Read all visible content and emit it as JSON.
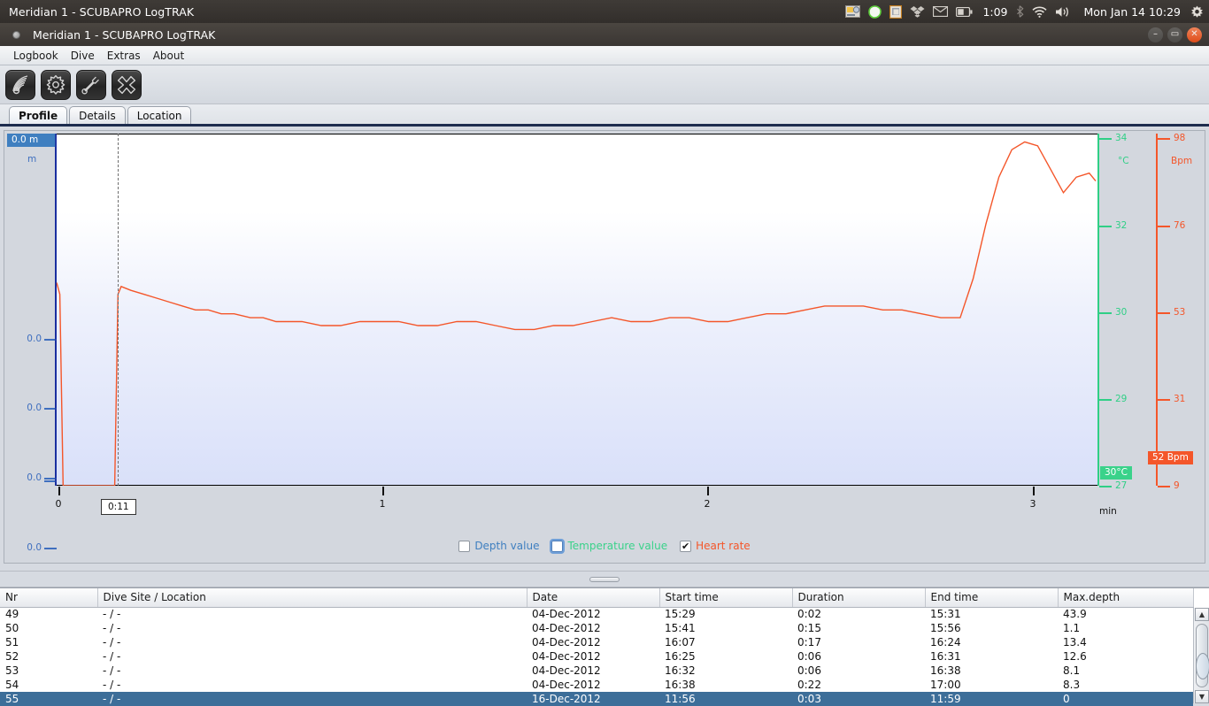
{
  "os_panel": {
    "title": "Meridian 1 - SCUBAPRO LogTRAK",
    "battery_time": "1:09",
    "clock": "Mon Jan 14  10:29",
    "tray_icons": [
      "screenshot-icon",
      "notes-icon",
      "clipboard-icon",
      "dropbox-icon",
      "mail-icon",
      "battery-icon",
      "bluetooth-icon",
      "wifi-icon",
      "volume-icon",
      "system-gear-icon"
    ]
  },
  "window": {
    "title": "Meridian 1 - SCUBAPRO LogTRAK",
    "minimize_label": "–",
    "maximize_label": "▭",
    "close_label": "✕"
  },
  "menu": {
    "items": [
      {
        "label": "Logbook"
      },
      {
        "label": "Dive"
      },
      {
        "label": "Extras"
      },
      {
        "label": "About"
      }
    ]
  },
  "toolbar": {
    "buttons": [
      {
        "name": "ir-transfer-icon"
      },
      {
        "name": "settings-gear-icon"
      },
      {
        "name": "tools-wrench-icon"
      },
      {
        "name": "close-x-icon"
      }
    ]
  },
  "tabs": [
    {
      "label": "Profile",
      "active": true
    },
    {
      "label": "Details",
      "active": false
    },
    {
      "label": "Location",
      "active": false
    }
  ],
  "chart_data": {
    "type": "line",
    "title": "",
    "xlabel": "min",
    "x_ticks": [
      0,
      1,
      2,
      3
    ],
    "xlim": [
      0,
      3.22
    ],
    "cursor_time": "0:11",
    "axes": [
      {
        "name": "depth",
        "unit": "m",
        "color": "#3f7fc0",
        "tick_labels": [
          "0.0",
          "0.0",
          "0.0",
          "0.0",
          "0.0"
        ],
        "tick_values": [
          0.0,
          0.0,
          0.0,
          0.0,
          0.0
        ],
        "badge": "0.0 m",
        "side": "left"
      },
      {
        "name": "temperature",
        "unit": "°C",
        "color": "#3ad28a",
        "tick_labels": [
          "34",
          "32",
          "30",
          "29",
          "27"
        ],
        "tick_values": [
          34,
          32,
          30,
          29,
          27
        ],
        "badge": "30°C",
        "side": "right"
      },
      {
        "name": "heart_rate",
        "unit": "Bpm",
        "color": "#f4562a",
        "tick_labels": [
          "98",
          "76",
          "53",
          "31",
          "9"
        ],
        "tick_values": [
          98,
          76,
          53,
          31,
          9
        ],
        "badge": "52 Bpm",
        "side": "right"
      }
    ],
    "series": [
      {
        "name": "Heart rate",
        "color": "#f4562a",
        "unit": "Bpm",
        "x": [
          0.0,
          0.01,
          0.02,
          0.18,
          0.19,
          0.2,
          0.23,
          0.27,
          0.31,
          0.35,
          0.39,
          0.43,
          0.47,
          0.51,
          0.55,
          0.6,
          0.64,
          0.68,
          0.72,
          0.76,
          0.82,
          0.88,
          0.94,
          1.0,
          1.06,
          1.12,
          1.18,
          1.24,
          1.3,
          1.36,
          1.42,
          1.48,
          1.54,
          1.6,
          1.66,
          1.72,
          1.78,
          1.84,
          1.9,
          1.96,
          2.02,
          2.08,
          2.14,
          2.2,
          2.26,
          2.32,
          2.38,
          2.44,
          2.5,
          2.56,
          2.62,
          2.68,
          2.74,
          2.8,
          2.84,
          2.88,
          2.92,
          2.96,
          3.0,
          3.04,
          3.08,
          3.12,
          3.16,
          3.2,
          3.22
        ],
        "values": [
          61,
          58,
          9,
          9,
          58,
          60,
          59,
          58,
          57,
          56,
          55,
          54,
          54,
          53,
          53,
          52,
          52,
          51,
          51,
          51,
          50,
          50,
          51,
          51,
          51,
          50,
          50,
          51,
          51,
          50,
          49,
          49,
          50,
          50,
          51,
          52,
          51,
          51,
          52,
          52,
          51,
          51,
          52,
          53,
          53,
          54,
          55,
          55,
          55,
          54,
          54,
          53,
          52,
          52,
          62,
          76,
          88,
          95,
          97,
          96,
          90,
          84,
          88,
          89,
          87
        ],
        "note": "Heart-rate trace; spike to 61 at start then drop to 9, resume at 0.19 min, mostly flat 49-55 Bpm, sharp rise after 2.8 min peaking ~97 Bpm near 3.05 min, dip then recovery"
      }
    ],
    "depth_trace": {
      "name": "Depth",
      "color": "#1a2fa0",
      "note": "Depth line collapsed at axis (all values 0.0 m)"
    },
    "legend": {
      "position": "bottom-center",
      "items": [
        {
          "label": "Depth value",
          "checked": false,
          "color": "#3f7fc0"
        },
        {
          "label": "Temperature value",
          "checked": false,
          "color": "#3ad28a",
          "focused": true
        },
        {
          "label": "Heart rate",
          "checked": true,
          "color": "#f4562a"
        }
      ]
    }
  },
  "table": {
    "columns": [
      "Nr",
      "Dive Site / Location",
      "Date",
      "Start time",
      "Duration",
      "End time",
      "Max.depth"
    ],
    "rows": [
      {
        "nr": "49",
        "site": "- / -",
        "date": "04-Dec-2012",
        "start": "15:29",
        "duration": "0:02",
        "end": "15:31",
        "max_depth": "43.9",
        "clipped": true,
        "selected": false
      },
      {
        "nr": "50",
        "site": "- / -",
        "date": "04-Dec-2012",
        "start": "15:41",
        "duration": "0:15",
        "end": "15:56",
        "max_depth": "1.1",
        "clipped": false,
        "selected": false
      },
      {
        "nr": "51",
        "site": "- / -",
        "date": "04-Dec-2012",
        "start": "16:07",
        "duration": "0:17",
        "end": "16:24",
        "max_depth": "13.4",
        "clipped": false,
        "selected": false
      },
      {
        "nr": "52",
        "site": "- / -",
        "date": "04-Dec-2012",
        "start": "16:25",
        "duration": "0:06",
        "end": "16:31",
        "max_depth": "12.6",
        "clipped": false,
        "selected": false
      },
      {
        "nr": "53",
        "site": "- / -",
        "date": "04-Dec-2012",
        "start": "16:32",
        "duration": "0:06",
        "end": "16:38",
        "max_depth": "8.1",
        "clipped": false,
        "selected": false
      },
      {
        "nr": "54",
        "site": "- / -",
        "date": "04-Dec-2012",
        "start": "16:38",
        "duration": "0:22",
        "end": "17:00",
        "max_depth": "8.3",
        "clipped": false,
        "selected": false
      },
      {
        "nr": "55",
        "site": "- / -",
        "date": "16-Dec-2012",
        "start": "11:56",
        "duration": "0:03",
        "end": "11:59",
        "max_depth": "0",
        "clipped": false,
        "selected": true
      }
    ],
    "scrollbar": {
      "up_arrow": "▲",
      "down_arrow": "▼"
    }
  }
}
